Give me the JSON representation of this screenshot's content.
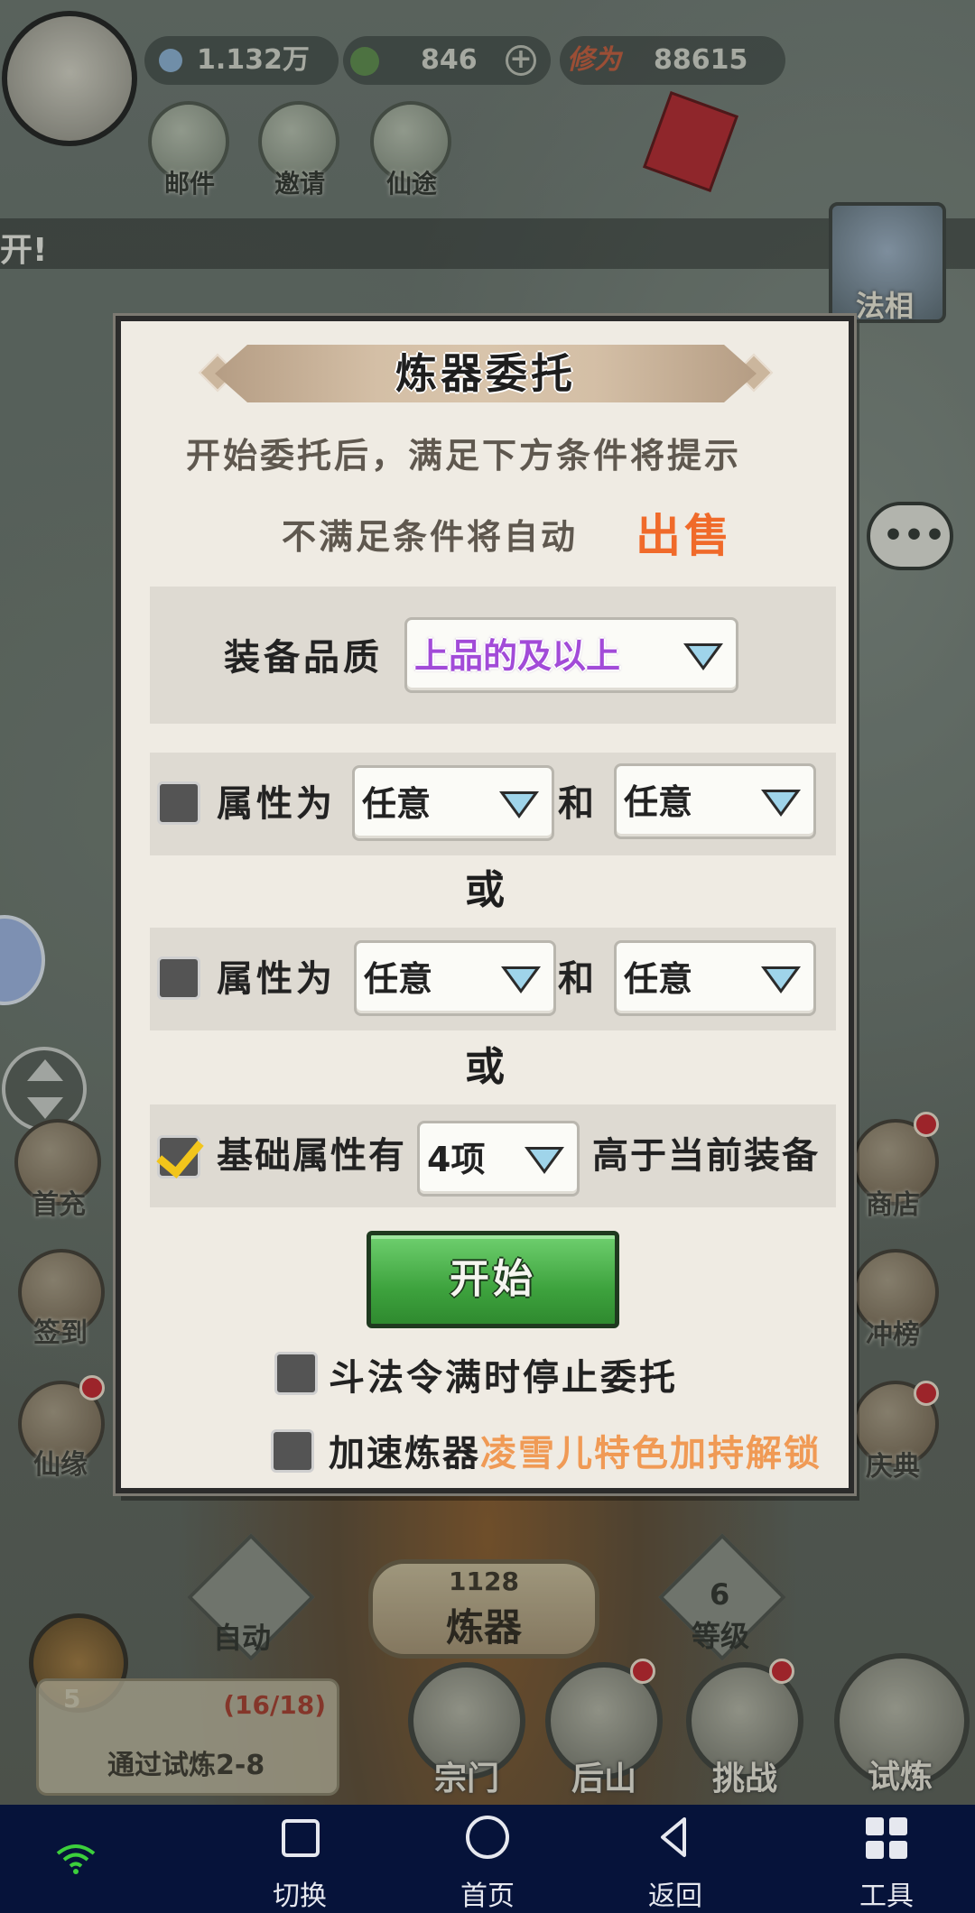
{
  "hud": {
    "spirit_stones": "1.132万",
    "jade": "846",
    "cultivation_label": "修为",
    "cultivation": "88615"
  },
  "top_menu": [
    {
      "label": "邮件",
      "icon": "mail-icon"
    },
    {
      "label": "邀请",
      "icon": "invite-icon"
    },
    {
      "label": "仙途",
      "icon": "path-icon"
    }
  ],
  "banner_text": "开!",
  "top_right": {
    "label": "法相"
  },
  "left_side": [
    {
      "label": "首充"
    },
    {
      "label": "签到"
    },
    {
      "label": "仙缘"
    }
  ],
  "right_side": [
    {
      "label": "商店"
    },
    {
      "label": "冲榜"
    },
    {
      "label": "庆典"
    }
  ],
  "bottom_area": {
    "auto_label": "自动",
    "refine_count": "1128",
    "refine_label": "炼器",
    "level_value": "6",
    "level_label": "等级",
    "chest_count": "5",
    "quest_progress": "(16/18)",
    "quest_text": "通过试炼2-8",
    "tabs": [
      "宗门",
      "后山",
      "挑战",
      "试炼"
    ]
  },
  "modal": {
    "title": "炼器委托",
    "desc_line1": "开始委托后，满足下方条件将提示",
    "desc_line2": "不满足条件将自动",
    "desc_sell": "出售",
    "quality_label": "装备品质",
    "quality_value": "上品的及以上",
    "attr_row1": {
      "checked": false,
      "label": "属性为",
      "value1": "任意",
      "and": "和",
      "value2": "任意"
    },
    "or1": "或",
    "attr_row2": {
      "checked": false,
      "label": "属性为",
      "value1": "任意",
      "and": "和",
      "value2": "任意"
    },
    "or2": "或",
    "base_row": {
      "checked": true,
      "label": "基础属性有",
      "value": "4项",
      "suffix": "高于当前装备"
    },
    "start_label": "开始",
    "option1": {
      "checked": false,
      "label": "斗法令满时停止委托"
    },
    "option2": {
      "checked": false,
      "label": "加速炼器",
      "hint": "凌雪儿特色加持解锁"
    }
  },
  "navbar": [
    {
      "label": "切换",
      "icon": "square-icon"
    },
    {
      "label": "首页",
      "icon": "home-circle-icon"
    },
    {
      "label": "返回",
      "icon": "back-triangle-icon"
    },
    {
      "label": "工具",
      "icon": "grid-icon"
    }
  ],
  "colors": {
    "sell_accent": "#f06a2a",
    "quality_purple": "#a24bd8",
    "hint_orange": "#f09a55",
    "start_green": "#3ea33e",
    "navbar_bg": "#06133a"
  }
}
